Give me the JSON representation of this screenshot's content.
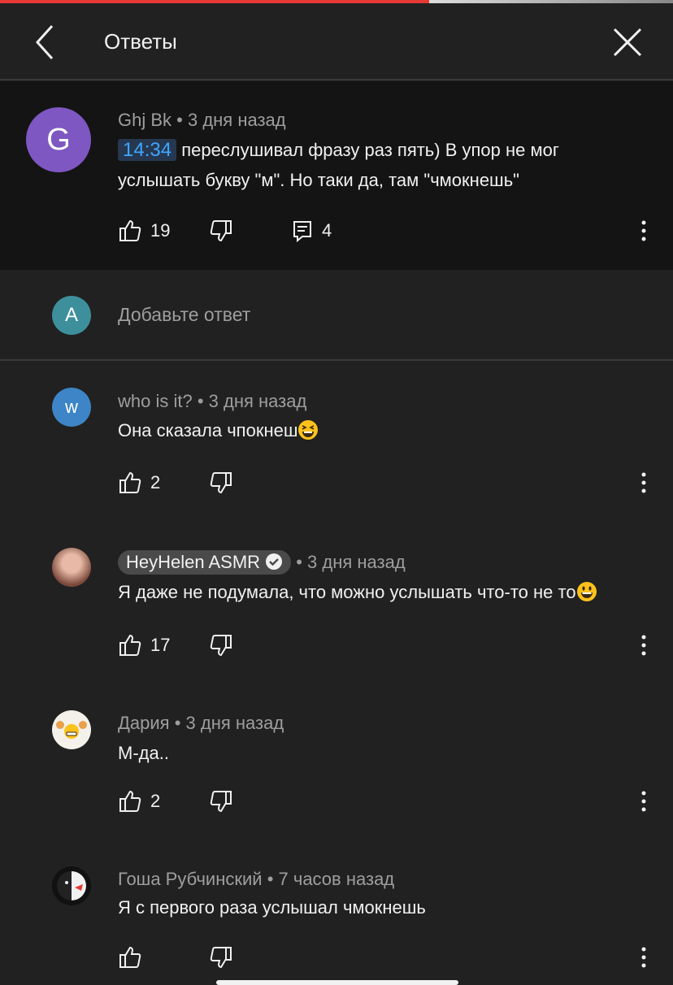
{
  "header": {
    "title": "Ответы"
  },
  "parent_comment": {
    "avatar_letter": "G",
    "author": "Ghj Bk",
    "time": "3 дня назад",
    "timestamp": "14:34",
    "text_line1": "переслушивал фразу раз пять) В упор не мог",
    "text_line2": "услышать букву \"м\". Но таки да, там \"чмокнешь\"",
    "likes": "19",
    "replies": "4",
    "avatar_color": "#7e57c2"
  },
  "add_reply": {
    "avatar_letter": "A",
    "placeholder": "Добавьте ответ",
    "avatar_color": "#3d8f9c"
  },
  "replies": [
    {
      "avatar_letter": "w",
      "author": "who is it?",
      "time": "3 дня назад",
      "text": "Она сказала чпокнеш",
      "emoji": "grinning-squinting-face",
      "likes": "2",
      "avatar_color": "#3d85c6"
    },
    {
      "author": "HeyHelen ASMR",
      "verified": true,
      "time": "3 дня назад",
      "text": "Я даже не подумала, что можно услышать что-то не то",
      "emoji": "grinning-face",
      "likes": "17"
    },
    {
      "author": "Дария",
      "time": "3 дня назад",
      "text": "М-да..",
      "likes": "2"
    },
    {
      "author": "Гоша Рубчинский",
      "time": "7 часов назад",
      "text": "Я с первого раза услышал чмокнешь",
      "likes": ""
    }
  ],
  "separator": " • ",
  "colors": {
    "accent_red": "#e53935",
    "timestamp_blue": "#3ea6ff",
    "background": "#212121",
    "parent_background": "#141414"
  }
}
